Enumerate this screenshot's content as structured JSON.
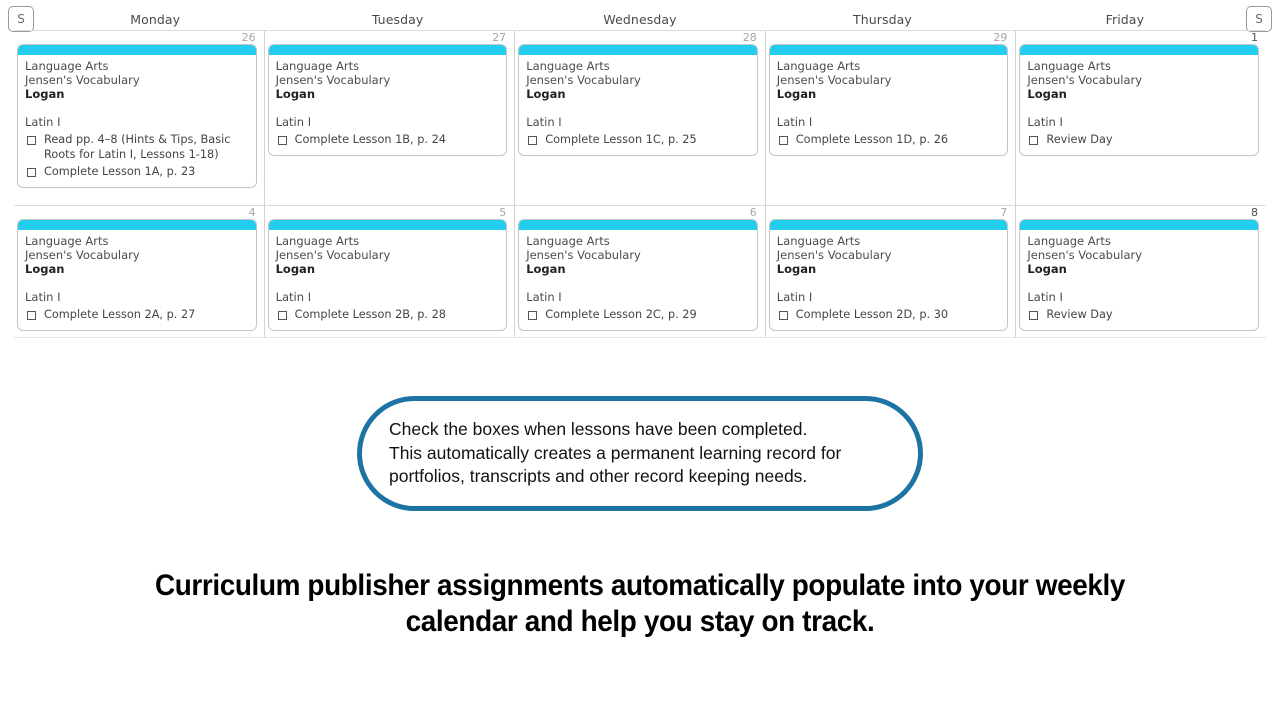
{
  "header": {
    "saturday_button_label": "S",
    "sunday_button_label": "S",
    "weekdays": [
      "Monday",
      "Tuesday",
      "Wednesday",
      "Thursday",
      "Friday"
    ]
  },
  "colors": {
    "card_accent": "#23cdee",
    "callout_border": "#1d74a4",
    "date_number": "#a7a7a7",
    "grid_line": "#d3d3d3"
  },
  "weeks": [
    {
      "days": [
        {
          "date": "26",
          "card": {
            "subject": "Language Arts",
            "curriculum": "Jensen's Vocabulary",
            "student": "Logan",
            "course": "Latin I",
            "tasks": [
              "Read pp. 4–8 (Hints & Tips, Basic Roots for Latin I, Lessons 1-18)",
              "Complete Lesson 1A, p. 23"
            ]
          }
        },
        {
          "date": "27",
          "card": {
            "subject": "Language Arts",
            "curriculum": "Jensen's Vocabulary",
            "student": "Logan",
            "course": "Latin I",
            "tasks": [
              "Complete Lesson 1B, p. 24"
            ]
          }
        },
        {
          "date": "28",
          "card": {
            "subject": "Language Arts",
            "curriculum": "Jensen's Vocabulary",
            "student": "Logan",
            "course": "Latin I",
            "tasks": [
              "Complete Lesson 1C, p. 25"
            ]
          }
        },
        {
          "date": "29",
          "card": {
            "subject": "Language Arts",
            "curriculum": "Jensen's Vocabulary",
            "student": "Logan",
            "course": "Latin I",
            "tasks": [
              "Complete Lesson 1D, p. 26"
            ]
          }
        },
        {
          "date": "1",
          "card": {
            "subject": "Language Arts",
            "curriculum": "Jensen's Vocabulary",
            "student": "Logan",
            "course": "Latin I",
            "tasks": [
              "Review Day"
            ]
          }
        }
      ]
    },
    {
      "days": [
        {
          "date": "4",
          "card": {
            "subject": "Language Arts",
            "curriculum": "Jensen's Vocabulary",
            "student": "Logan",
            "course": "Latin I",
            "tasks": [
              "Complete Lesson 2A, p. 27"
            ]
          }
        },
        {
          "date": "5",
          "card": {
            "subject": "Language Arts",
            "curriculum": "Jensen's Vocabulary",
            "student": "Logan",
            "course": "Latin I",
            "tasks": [
              "Complete Lesson 2B, p. 28"
            ]
          }
        },
        {
          "date": "6",
          "card": {
            "subject": "Language Arts",
            "curriculum": "Jensen's Vocabulary",
            "student": "Logan",
            "course": "Latin I",
            "tasks": [
              "Complete Lesson 2C, p. 29"
            ]
          }
        },
        {
          "date": "7",
          "card": {
            "subject": "Language Arts",
            "curriculum": "Jensen's Vocabulary",
            "student": "Logan",
            "course": "Latin I",
            "tasks": [
              "Complete Lesson 2D, p. 30"
            ]
          }
        },
        {
          "date": "8",
          "card": {
            "subject": "Language Arts",
            "curriculum": "Jensen's Vocabulary",
            "student": "Logan",
            "course": "Latin I",
            "tasks": [
              "Review Day"
            ]
          }
        }
      ]
    }
  ],
  "callout": {
    "lines": [
      "Check the boxes when lessons have been completed.",
      "This automatically creates a permanent learning record for",
      "portfolios, transcripts and other record keeping needs."
    ]
  },
  "headline": {
    "lines": [
      "Curriculum publisher assignments automatically populate into your weekly",
      "calendar and help you stay on track."
    ]
  }
}
